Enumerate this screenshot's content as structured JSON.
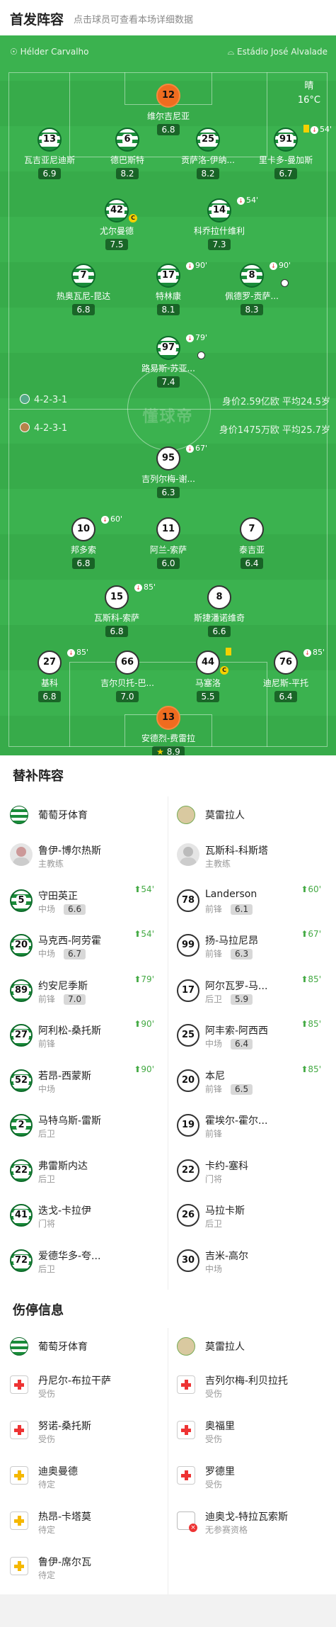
{
  "header": {
    "title": "首发阵容",
    "subtitle": "点击球员可查看本场详细数据"
  },
  "pitch": {
    "referee": "Hélder Carvalho",
    "stadium": "Estádio José Alvalade",
    "weather": "晴",
    "temperature": "16°C",
    "watermark": "懂球帝",
    "home_formation": "4-2-3-1",
    "home_value": "身价2.59亿欧  平均24.5岁",
    "away_formation": "4-2-3-1",
    "away_value": "身价1475万欧  平均25.7岁"
  },
  "home_players": [
    {
      "num": "12",
      "name": "维尔吉尼亚",
      "rating": "6.8",
      "kit": "gk1",
      "marks": ""
    },
    {
      "num": "13",
      "name": "瓦吉亚尼迪斯",
      "rating": "6.9",
      "kit": "sp",
      "marks": ""
    },
    {
      "num": "6",
      "name": "德巴斯特",
      "rating": "8.2",
      "kit": "sp",
      "marks": ""
    },
    {
      "num": "25",
      "name": "贡萨洛-伊纳...",
      "rating": "8.2",
      "kit": "sp",
      "marks": ""
    },
    {
      "num": "91",
      "name": "里卡多-曼加斯",
      "rating": "6.7",
      "kit": "sp",
      "marks": "54'"
    },
    {
      "num": "42",
      "name": "尤尔曼德",
      "rating": "7.5",
      "kit": "sp",
      "marks": ""
    },
    {
      "num": "14",
      "name": "科乔拉什维利",
      "rating": "7.3",
      "kit": "sp",
      "marks": "54'"
    },
    {
      "num": "7",
      "name": "热奥瓦尼-昆达",
      "rating": "6.8",
      "kit": "sp",
      "marks": ""
    },
    {
      "num": "17",
      "name": "特林康",
      "rating": "8.1",
      "kit": "sp",
      "marks": "90'"
    },
    {
      "num": "8",
      "name": "佩德罗-贡萨...",
      "rating": "8.3",
      "kit": "sp",
      "marks": "90'"
    },
    {
      "num": "97",
      "name": "路易斯-苏亚...",
      "rating": "7.4",
      "kit": "sp",
      "marks": "79'"
    }
  ],
  "away_players": [
    {
      "num": "95",
      "name": "吉列尔梅-谢...",
      "rating": "6.3",
      "kit": "mo",
      "marks": "67'"
    },
    {
      "num": "10",
      "name": "邦多索",
      "rating": "6.8",
      "kit": "mo",
      "marks": "60'"
    },
    {
      "num": "11",
      "name": "阿兰-索萨",
      "rating": "6.0",
      "kit": "mo",
      "marks": ""
    },
    {
      "num": "7",
      "name": "泰吉亚",
      "rating": "6.4",
      "kit": "mo",
      "marks": ""
    },
    {
      "num": "15",
      "name": "瓦斯科-索萨",
      "rating": "6.8",
      "kit": "mo",
      "marks": "85'"
    },
    {
      "num": "8",
      "name": "斯捷潘诺维奇",
      "rating": "6.6",
      "kit": "mo",
      "marks": ""
    },
    {
      "num": "27",
      "name": "基科",
      "rating": "6.8",
      "kit": "mo",
      "marks": "85'"
    },
    {
      "num": "66",
      "name": "吉尔贝托-巴...",
      "rating": "7.0",
      "kit": "mo",
      "marks": ""
    },
    {
      "num": "44",
      "name": "马塞洛",
      "rating": "5.5",
      "kit": "mo",
      "marks": ""
    },
    {
      "num": "76",
      "name": "迪尼斯-平托",
      "rating": "6.4",
      "kit": "mo",
      "marks": "85'"
    },
    {
      "num": "13",
      "name": "安德烈-费雷拉",
      "rating": "8.9",
      "kit": "gk1",
      "marks": ""
    }
  ],
  "subs": {
    "title": "替补阵容",
    "home_team": "葡萄牙体育",
    "away_team": "莫雷拉人",
    "home": [
      {
        "num": "",
        "name": "鲁伊-博尔热斯",
        "pos": "主教练",
        "rating": "",
        "ev": ""
      },
      {
        "num": "5",
        "name": "守田英正",
        "pos": "中场",
        "rating": "6.6",
        "ev": "54'"
      },
      {
        "num": "20",
        "name": "马克西-阿劳霍",
        "pos": "中场",
        "rating": "6.7",
        "ev": "54'"
      },
      {
        "num": "89",
        "name": "约安尼季斯",
        "pos": "前锋",
        "rating": "7.0",
        "ev": "79'"
      },
      {
        "num": "27",
        "name": "阿利松-桑托斯",
        "pos": "前锋",
        "rating": "",
        "ev": "90'"
      },
      {
        "num": "52",
        "name": "若昂-西蒙斯",
        "pos": "中场",
        "rating": "",
        "ev": "90'"
      },
      {
        "num": "2",
        "name": "马特乌斯-雷斯",
        "pos": "后卫",
        "rating": "",
        "ev": ""
      },
      {
        "num": "22",
        "name": "弗雷斯内达",
        "pos": "后卫",
        "rating": "",
        "ev": ""
      },
      {
        "num": "41",
        "name": "迭戈-卡拉伊",
        "pos": "门将",
        "rating": "",
        "ev": ""
      },
      {
        "num": "72",
        "name": "爱德华多-夸...",
        "pos": "后卫",
        "rating": "",
        "ev": ""
      }
    ],
    "away": [
      {
        "num": "",
        "name": "瓦斯科-科斯塔",
        "pos": "主教练",
        "rating": "",
        "ev": ""
      },
      {
        "num": "78",
        "name": "Landerson",
        "pos": "前锋",
        "rating": "6.1",
        "ev": "60'"
      },
      {
        "num": "99",
        "name": "扬-马拉尼昂",
        "pos": "前锋",
        "rating": "6.3",
        "ev": "67'"
      },
      {
        "num": "17",
        "name": "阿尔瓦罗-马...",
        "pos": "后卫",
        "rating": "5.9",
        "ev": "85'"
      },
      {
        "num": "25",
        "name": "阿丰索-阿西西",
        "pos": "中场",
        "rating": "6.4",
        "ev": "85'"
      },
      {
        "num": "20",
        "name": "本尼",
        "pos": "前锋",
        "rating": "6.5",
        "ev": "85'"
      },
      {
        "num": "19",
        "name": "霍埃尔-霍尔...",
        "pos": "前锋",
        "rating": "",
        "ev": ""
      },
      {
        "num": "22",
        "name": "卡约-塞科",
        "pos": "门将",
        "rating": "",
        "ev": ""
      },
      {
        "num": "26",
        "name": "马拉卡斯",
        "pos": "后卫",
        "rating": "",
        "ev": ""
      },
      {
        "num": "30",
        "name": "吉米-高尔",
        "pos": "中场",
        "rating": "",
        "ev": ""
      }
    ]
  },
  "injuries": {
    "title": "伤停信息",
    "home_team": "葡萄牙体育",
    "away_team": "莫雷拉人",
    "home": [
      {
        "name": "丹尼尔-布拉干萨",
        "status": "受伤",
        "type": "red"
      },
      {
        "name": "努诺-桑托斯",
        "status": "受伤",
        "type": "red"
      },
      {
        "name": "迪奥曼德",
        "status": "待定",
        "type": "yel"
      },
      {
        "name": "热昂-卡塔莫",
        "status": "待定",
        "type": "yel"
      },
      {
        "name": "鲁伊-席尔瓦",
        "status": "待定",
        "type": "yel"
      }
    ],
    "away": [
      {
        "name": "吉列尔梅-利贝拉托",
        "status": "受伤",
        "type": "red"
      },
      {
        "name": "奥福里",
        "status": "受伤",
        "type": "red"
      },
      {
        "name": "罗德里",
        "status": "受伤",
        "type": "red"
      },
      {
        "name": "迪奥戈-特拉瓦索斯",
        "status": "无参赛资格",
        "type": "doc"
      }
    ]
  }
}
